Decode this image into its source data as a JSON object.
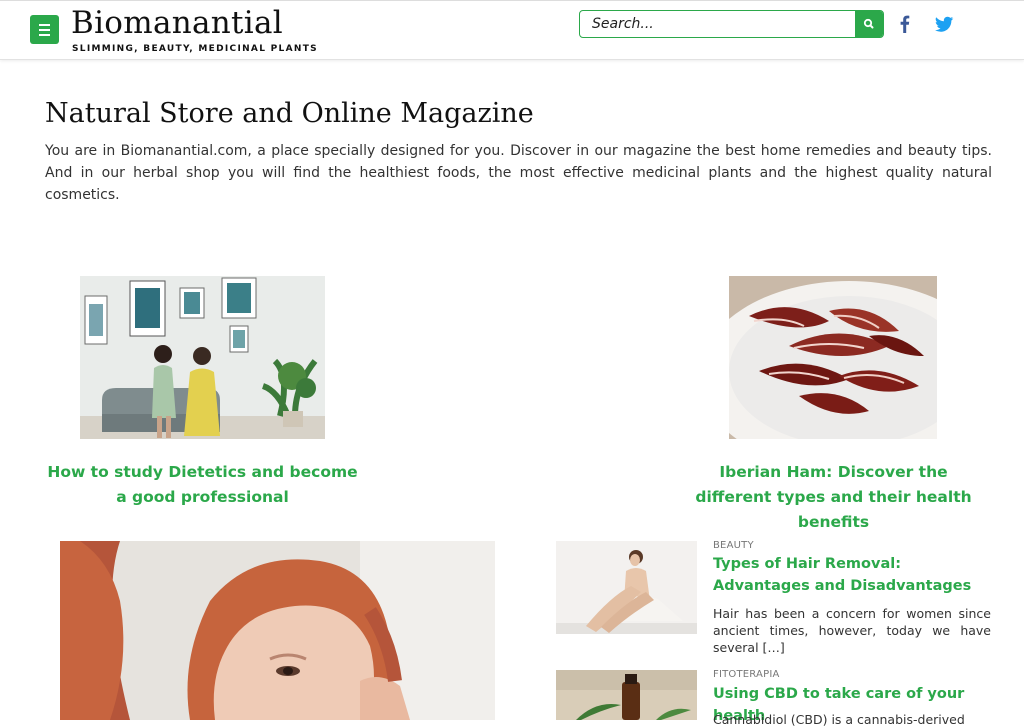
{
  "header": {
    "site_title": "Biomanantial",
    "tagline": "SLIMMING, BEAUTY, MEDICINAL PLANTS",
    "search_placeholder": "Search...",
    "menu_icon": "hamburger-menu-icon",
    "search_icon": "magnifier-icon",
    "social": [
      "facebook-icon",
      "twitter-icon"
    ]
  },
  "intro": {
    "title": "Natural Store and Online Magazine",
    "text": "You are in Biomanantial.com, a place specially designed for you. Discover in our magazine the best home remedies and beauty tips. And in our herbal shop you will find the healthiest foods, the most effective medicinal plants and the highest quality natural cosmetics."
  },
  "featured": [
    {
      "title": "How to study Dietetics and become a good professional"
    },
    {
      "title": "Iberian Ham: Discover the different types and their health benefits"
    }
  ],
  "posts": [
    {
      "category": "BEAUTY",
      "title": "Types of Hair Removal: Advantages and Disadvantages",
      "excerpt": "Hair has been a concern for women since ancient times, however, today we have several […]"
    },
    {
      "category": "FITOTERAPIA",
      "title": "Using CBD to take care of your health",
      "excerpt": "Cannabidiol (CBD) is a cannabis-derived"
    }
  ],
  "colors": {
    "accent": "#2ba84a",
    "facebook": "#3b5998",
    "twitter": "#1da1f2"
  }
}
